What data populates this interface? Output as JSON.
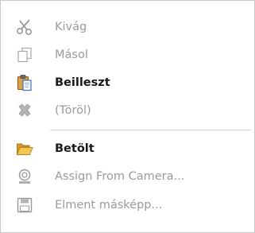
{
  "menu": {
    "items": [
      {
        "label": "Kivág",
        "icon": "scissors-icon",
        "enabled": false
      },
      {
        "label": "Másol",
        "icon": "copy-icon",
        "enabled": false
      },
      {
        "label": "Beilleszt",
        "icon": "paste-icon",
        "enabled": true
      },
      {
        "label": "(Töröl)",
        "icon": "delete-x-icon",
        "enabled": false
      },
      {
        "label": "Betölt",
        "icon": "folder-open-icon",
        "enabled": true
      },
      {
        "label": "Assign From Camera...",
        "icon": "camera-icon",
        "enabled": false
      },
      {
        "label": "Elment másképp...",
        "icon": "save-disk-icon",
        "enabled": false
      }
    ]
  },
  "colors": {
    "disabled_text": "#9a9a9a",
    "enabled_text": "#1a1a1a",
    "border": "#c9c9c9",
    "separator": "#d6d6d6",
    "folder": "#e8b84a",
    "clipboard": "#c98a2e"
  }
}
